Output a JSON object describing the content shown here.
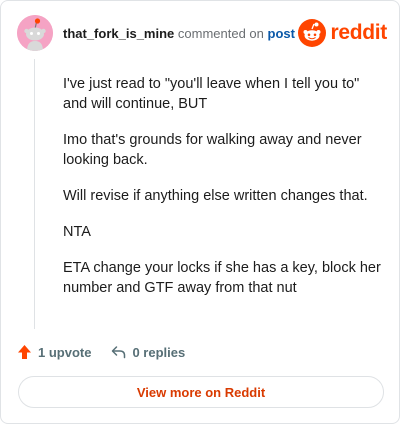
{
  "comment": {
    "username": "that_fork_is_mine",
    "action": "commented on",
    "post_link": "post",
    "paragraphs": [
      "I've just read to \"you'll leave when I tell you to\" and will continue, BUT",
      "Imo that's grounds for walking away and never looking back.",
      "Will revise if anything else written changes that.",
      "NTA",
      "ETA change your locks if she has a key, block her number and GTF away from that nut"
    ]
  },
  "brand": {
    "wordmark": "reddit",
    "icon": "reddit-logo-icon"
  },
  "avatar": {
    "icon": "snoo-avatar-icon",
    "color": "#f5a3c4"
  },
  "actions": {
    "upvote_label": "1 upvote",
    "upvote_icon": "upvote-arrow-icon",
    "replies_label": "0 replies",
    "replies_icon": "reply-arrow-icon"
  },
  "footer": {
    "view_more_label": "View more on Reddit"
  },
  "colors": {
    "accent": "#ff4500",
    "link": "#0a58a8",
    "cta": "#d93a00"
  }
}
